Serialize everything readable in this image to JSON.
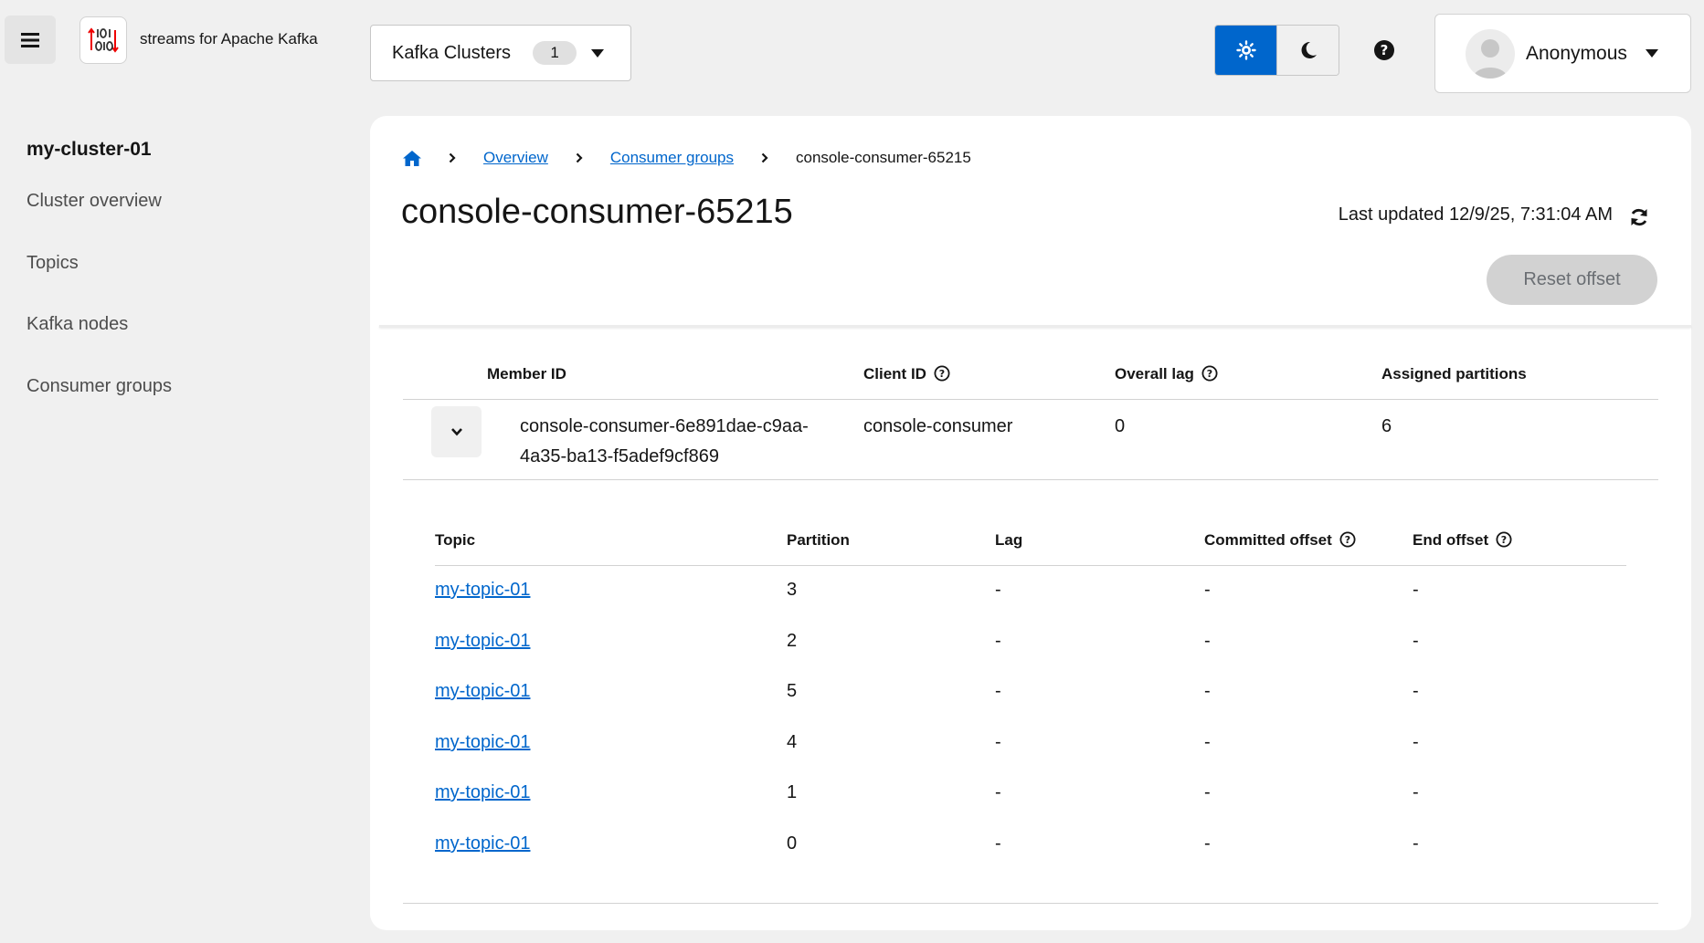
{
  "masthead": {
    "brand": "streams for Apache Kafka",
    "cluster_selector": {
      "label": "Kafka Clusters",
      "count": "1"
    },
    "user": {
      "name": "Anonymous"
    },
    "accent_color": "#0066cc"
  },
  "sidebar": {
    "cluster_name": "my-cluster-01",
    "items": [
      {
        "label": "Cluster overview"
      },
      {
        "label": "Topics"
      },
      {
        "label": "Kafka nodes"
      },
      {
        "label": "Consumer groups"
      }
    ]
  },
  "breadcrumb": {
    "items": [
      {
        "label": "Overview"
      },
      {
        "label": "Consumer groups"
      },
      {
        "label": "console-consumer-65215"
      }
    ]
  },
  "page": {
    "title": "console-consumer-65215",
    "last_updated": "Last updated 12/9/25, 7:31:04 AM",
    "reset_button": "Reset offset"
  },
  "members_table": {
    "columns": [
      "Member ID",
      "Client ID",
      "Overall lag",
      "Assigned partitions"
    ],
    "rows": [
      {
        "member_id": "console-consumer-6e891dae-c9aa-4a35-ba13-f5adef9cf869",
        "client_id": "console-consumer",
        "overall_lag": "0",
        "assigned_partitions": "6"
      }
    ]
  },
  "partitions_table": {
    "columns": [
      "Topic",
      "Partition",
      "Lag",
      "Committed offset",
      "End offset"
    ],
    "rows": [
      {
        "topic": "my-topic-01",
        "partition": "3",
        "lag": "-",
        "committed": "-",
        "end": "-"
      },
      {
        "topic": "my-topic-01",
        "partition": "2",
        "lag": "-",
        "committed": "-",
        "end": "-"
      },
      {
        "topic": "my-topic-01",
        "partition": "5",
        "lag": "-",
        "committed": "-",
        "end": "-"
      },
      {
        "topic": "my-topic-01",
        "partition": "4",
        "lag": "-",
        "committed": "-",
        "end": "-"
      },
      {
        "topic": "my-topic-01",
        "partition": "1",
        "lag": "-",
        "committed": "-",
        "end": "-"
      },
      {
        "topic": "my-topic-01",
        "partition": "0",
        "lag": "-",
        "committed": "-",
        "end": "-"
      }
    ]
  }
}
